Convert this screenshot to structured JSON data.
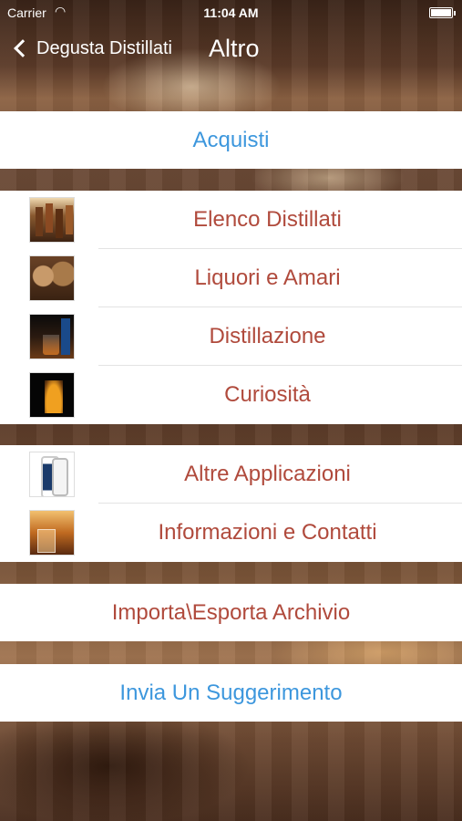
{
  "status_bar": {
    "carrier": "Carrier",
    "time": "11:04 AM"
  },
  "nav": {
    "back_label": "Degusta Distillati",
    "title": "Altro"
  },
  "rows": {
    "acquisti": "Acquisti",
    "importa": "Importa\\Esporta Archivio",
    "suggerimento": "Invia Un Suggerimento"
  },
  "group1": [
    {
      "label": "Elenco Distillati",
      "icon": "bottles-thumbnail"
    },
    {
      "label": "Liquori e Amari",
      "icon": "barrels-thumbnail"
    },
    {
      "label": "Distillazione",
      "icon": "glass-thumbnail"
    },
    {
      "label": "Curiosità",
      "icon": "dark-bottle-thumbnail"
    }
  ],
  "group2": [
    {
      "label": "Altre Applicazioni",
      "icon": "phone-thumbnail"
    },
    {
      "label": "Informazioni e Contatti",
      "icon": "whisky-thumbnail"
    }
  ],
  "colors": {
    "link_blue": "#3d97dd",
    "label_red": "#b04a3c"
  }
}
